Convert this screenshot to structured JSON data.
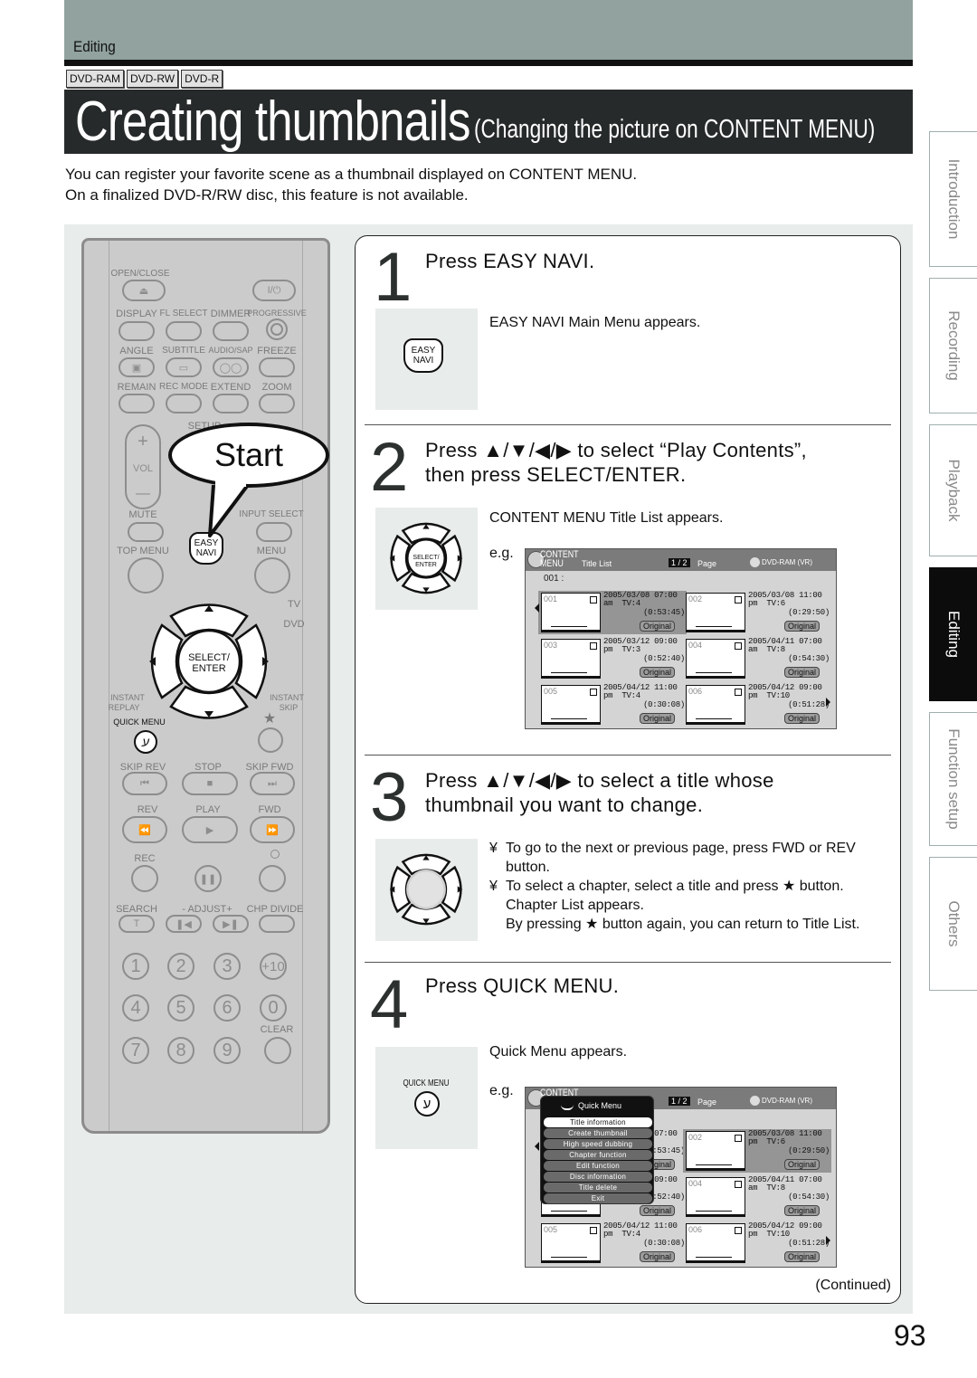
{
  "header": {
    "section": "Editing",
    "disc_tags": [
      "DVD-RAM",
      "DVD-RW",
      "DVD-R"
    ],
    "title": "Creating thumbnails",
    "subtitle": "(Changing the picture on CONTENT MENU)"
  },
  "intro": [
    "You can register your favorite scene as a thumbnail displayed on CONTENT MENU.",
    "On a finalized DVD-R/RW disc, this feature is not available."
  ],
  "side_tabs": [
    {
      "label": "Introduction",
      "active": false
    },
    {
      "label": "Recording",
      "active": false
    },
    {
      "label": "Playback",
      "active": false
    },
    {
      "label": "Editing",
      "active": true
    },
    {
      "label": "Function setup",
      "active": false
    },
    {
      "label": "Others",
      "active": false
    }
  ],
  "remote": {
    "start_label": "Start",
    "labels": {
      "open_close": "OPEN/CLOSE",
      "power": "I/⏻",
      "display": "DISPLAY",
      "fl_select": "FL SELECT",
      "dimmer": "DIMMER",
      "progressive": "PROGRESSIVE",
      "angle": "ANGLE",
      "subtitle": "SUBTITLE",
      "audio_sap": "AUDIO/SAP",
      "freeze": "FREEZE",
      "remain": "REMAIN",
      "rec_mode": "REC MODE",
      "extend": "EXTEND",
      "zoom": "ZOOM",
      "setup": "SETUP",
      "vol": "VOL",
      "vol_plus": "+",
      "vol_minus": "—",
      "mute": "MUTE",
      "input_select": "INPUT SELECT",
      "top_menu": "TOP MENU",
      "easy_navi_1": "EASY",
      "easy_navi_2": "NAVI",
      "menu": "MENU",
      "tv": "TV",
      "dvd": "DVD",
      "select_1": "SELECT/",
      "select_2": "ENTER",
      "instant_replay_1": "INSTANT",
      "instant_replay_2": "REPLAY",
      "instant_skip_1": "INSTANT",
      "instant_skip_2": "SKIP",
      "quick_menu": "QUICK MENU",
      "skip_rev": "SKIP REV",
      "stop": "STOP",
      "skip_fwd": "SKIP FWD",
      "rev": "REV",
      "play": "PLAY",
      "fwd": "FWD",
      "rec": "REC",
      "search": "SEARCH",
      "adjust": "- ADJUST+",
      "chp_divide": "CHP DIVIDE",
      "search_t": "T",
      "clear": "CLEAR"
    },
    "number_keys": [
      "1",
      "2",
      "3",
      "+10",
      "4",
      "5",
      "6",
      "0",
      "7",
      "8",
      "9"
    ]
  },
  "steps": [
    {
      "number": "1",
      "title": "Press EASY NAVI.",
      "icon": "easy-navi-button",
      "icon_label_1": "EASY",
      "icon_label_2": "NAVI",
      "text": "EASY NAVI Main Menu appears."
    },
    {
      "number": "2",
      "title_1": "Press ▲/▼/◀/▶ to select “Play Contents”,",
      "title_2": "then press SELECT/ENTER.",
      "icon": "dpad",
      "icon_label_1": "SELECT/",
      "icon_label_2": "ENTER",
      "text": "CONTENT MENU Title List appears.",
      "eg": "e.g."
    },
    {
      "number": "3",
      "title_1": "Press ▲/▼/◀/▶ to select a title whose",
      "title_2": "thumbnail you want to change.",
      "icon": "dpad",
      "bullet_marker": "¥",
      "bullets": [
        "To go to the next or previous page, press FWD or REV button.",
        "To select a chapter, select a title and press ★ button. Chapter List appears."
      ],
      "extra": "By pressing ★ button again, you can return to Title List."
    },
    {
      "number": "4",
      "title": "Press QUICK MENU.",
      "icon": "quick-menu-button",
      "icon_label": "QUICK MENU",
      "text": "Quick Menu appears.",
      "eg": "e.g."
    }
  ],
  "content_menu": {
    "brand_1": "CONTENT",
    "brand_2": "MENU",
    "list_title": "Title List",
    "page": "1 / 2",
    "page_label": "Page",
    "media": "DVD-RAM (VR)",
    "selected": "001 :",
    "titles": [
      {
        "num": "001",
        "date": "2005/03/08 07:00",
        "ch": "am  TV:4",
        "duration": "(0:53:45)",
        "type": "Original"
      },
      {
        "num": "002",
        "date": "2005/03/08 11:00",
        "ch": "pm  TV:6",
        "duration": "(0:29:50)",
        "type": "Original"
      },
      {
        "num": "003",
        "date": "2005/03/12 09:00",
        "ch": "pm  TV:3",
        "duration": "(0:52:40)",
        "type": "Original"
      },
      {
        "num": "004",
        "date": "2005/04/11 07:00",
        "ch": "am  TV:8",
        "duration": "(0:54:30)",
        "type": "Original"
      },
      {
        "num": "005",
        "date": "2005/04/12 11:00",
        "ch": "pm  TV:4",
        "duration": "(0:30:08)",
        "type": "Original"
      },
      {
        "num": "006",
        "date": "2005/04/12 09:00",
        "ch": "pm  TV:10",
        "duration": "(0:51:28)",
        "type": "Original"
      }
    ]
  },
  "quick_menu": {
    "title": "Quick Menu",
    "items": [
      "Title information",
      "Create thumbnail",
      "High speed dubbing",
      "Chapter function",
      "Edit function",
      "Disc information",
      "Title delete",
      "Exit"
    ],
    "selected_index": 0
  },
  "footer": {
    "continued": "(Continued)",
    "page_number": "93"
  }
}
